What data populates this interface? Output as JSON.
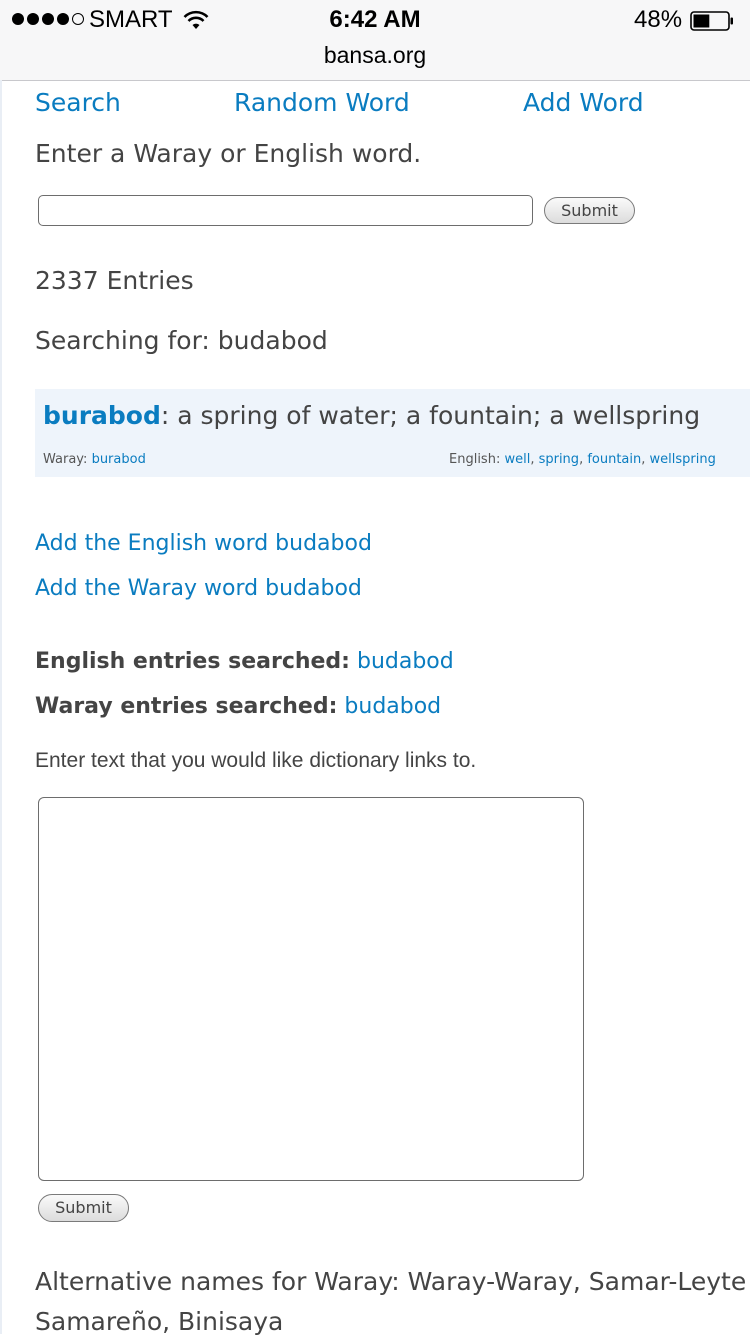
{
  "status_bar": {
    "carrier": "SMART",
    "time": "6:42 AM",
    "battery": "48%",
    "battery_level": 0.48,
    "url": "bansa.org"
  },
  "nav": {
    "search": "Search",
    "random": "Random Word",
    "add": "Add Word"
  },
  "search": {
    "prompt": "Enter a Waray or English word.",
    "value": "",
    "submit_label": "Submit"
  },
  "entries_count": "2337 Entries",
  "searching_for": "Searching for: budabod",
  "result": {
    "word": "burabod",
    "definition": ": a spring of water; a fountain; a wellspring",
    "waray_label": "Waray: ",
    "waray_word": "burabod",
    "english_label": "English: ",
    "english_words": [
      "well",
      "spring",
      "fountain",
      "wellspring"
    ]
  },
  "add_links": {
    "english": "Add the English word budabod",
    "waray": "Add the Waray word budabod"
  },
  "searched": {
    "english_label": "English entries searched:",
    "english_value": "budabod",
    "waray_label": "Waray entries searched:",
    "waray_value": "budabod"
  },
  "text_links": {
    "prompt": "Enter text that you would like dictionary links to.",
    "value": "",
    "submit_label": "Submit"
  },
  "alt_names": {
    "line1": "Alternative names for Waray: Waray-Waray, Samar-Leyte",
    "line2": "Samareño, Binisaya"
  }
}
